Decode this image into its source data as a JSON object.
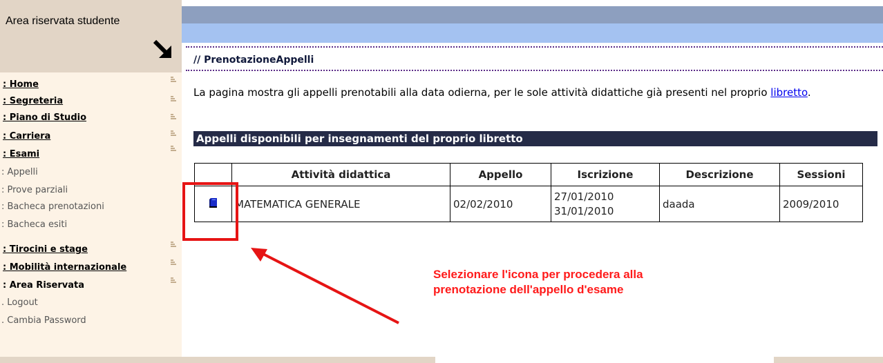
{
  "sidebar": {
    "title": "Area riservata studente",
    "items": [
      {
        "label": ": Home"
      },
      {
        "label": ": Segreteria"
      },
      {
        "label": ": Piano di Studio"
      },
      {
        "label": ": Carriera"
      },
      {
        "label": ": Esami"
      }
    ],
    "esami_sub": [
      {
        "label": ": Appelli"
      },
      {
        "label": ": Prove parziali"
      },
      {
        "label": ": Bacheca prenotazioni"
      },
      {
        "label": ": Bacheca esiti"
      }
    ],
    "items2": [
      {
        "label": ": Tirocini e stage"
      },
      {
        "label": ": Mobilità internazionale"
      },
      {
        "label": ": Area Riservata"
      }
    ],
    "riservata_sub": [
      {
        "label": ". Logout"
      },
      {
        "label": ". Cambia Password"
      }
    ]
  },
  "main": {
    "heading": "// PrenotazioneAppelli",
    "intro_text": "La pagina mostra gli appelli prenotabili alla data odierna, per le sole attività didattiche già presenti nel proprio ",
    "intro_link": "libretto",
    "intro_end": ".",
    "section_title": "Appelli disponibili per insegnamenti del proprio libretto",
    "table": {
      "headers": [
        "",
        "Attività didattica",
        "Appello",
        "Iscrizione",
        "Descrizione",
        "Sessioni"
      ],
      "rows": [
        {
          "icon": "book-icon",
          "attivita": "MATEMATICA GENERALE",
          "appello": "02/02/2010",
          "iscrizione_da": "27/01/2010",
          "iscrizione_a": "31/01/2010",
          "descrizione": "daada",
          "sessioni": "2009/2010"
        }
      ]
    }
  },
  "annotation": {
    "line1": "Selezionare l'icona per procedera alla",
    "line2": "prenotazione dell'appello d'esame"
  },
  "colors": {
    "annotation_red": "#e61414",
    "section_bar": "#252b47",
    "top_bar_dark": "#8d9fbf",
    "top_bar_light": "#a4c2f1",
    "sidebar_bg": "#fdf3e6",
    "sidebar_header_bg": "#e2d5c6"
  }
}
